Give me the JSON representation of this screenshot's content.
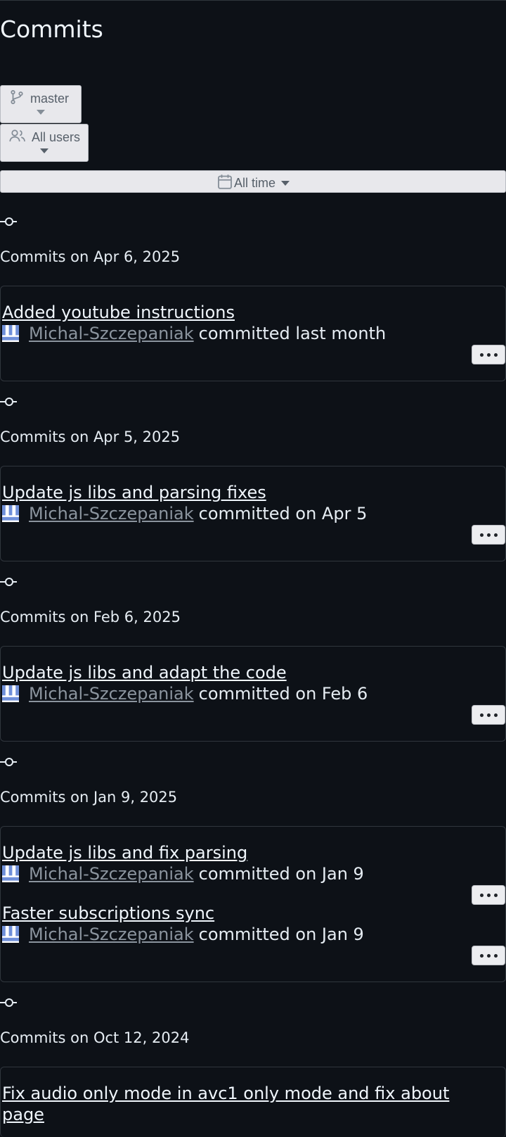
{
  "page": {
    "title": "Commits"
  },
  "filters": {
    "branch_label": "master",
    "users_label": "All users",
    "time_label": "All time"
  },
  "groups": [
    {
      "date_label": "Commits on Apr 6, 2025",
      "commits": [
        {
          "title": "Added youtube instructions",
          "author": "Michal-Szczepaniak",
          "meta": "committed last month"
        }
      ]
    },
    {
      "date_label": "Commits on Apr 5, 2025",
      "commits": [
        {
          "title": "Update js libs and parsing fixes",
          "author": "Michal-Szczepaniak",
          "meta": "committed on Apr 5"
        }
      ]
    },
    {
      "date_label": "Commits on Feb 6, 2025",
      "commits": [
        {
          "title": "Update js libs and adapt the code",
          "author": "Michal-Szczepaniak",
          "meta": "committed on Feb 6"
        }
      ]
    },
    {
      "date_label": "Commits on Jan 9, 2025",
      "commits": [
        {
          "title": "Update js libs and fix parsing",
          "author": "Michal-Szczepaniak",
          "meta": "committed on Jan 9"
        },
        {
          "title": "Faster subscriptions sync",
          "author": "Michal-Szczepaniak",
          "meta": "committed on Jan 9"
        }
      ]
    },
    {
      "date_label": "Commits on Oct 12, 2024",
      "commits": [
        {
          "title": "Fix audio only mode in avc1 only mode and fix about page"
        }
      ]
    }
  ],
  "icons": {
    "branch": "git-branch-icon",
    "users": "people-icon",
    "calendar": "calendar-icon",
    "commit": "git-commit-icon",
    "avatar": "identicon-avatar",
    "more": "kebab-horizontal-icon"
  },
  "colors": {
    "background": "#0d1117",
    "text": "#e6edf3",
    "muted": "#8b949e",
    "border": "#30363d",
    "button_bg": "#e8e8ec",
    "avatar": "#6f8fd9"
  }
}
